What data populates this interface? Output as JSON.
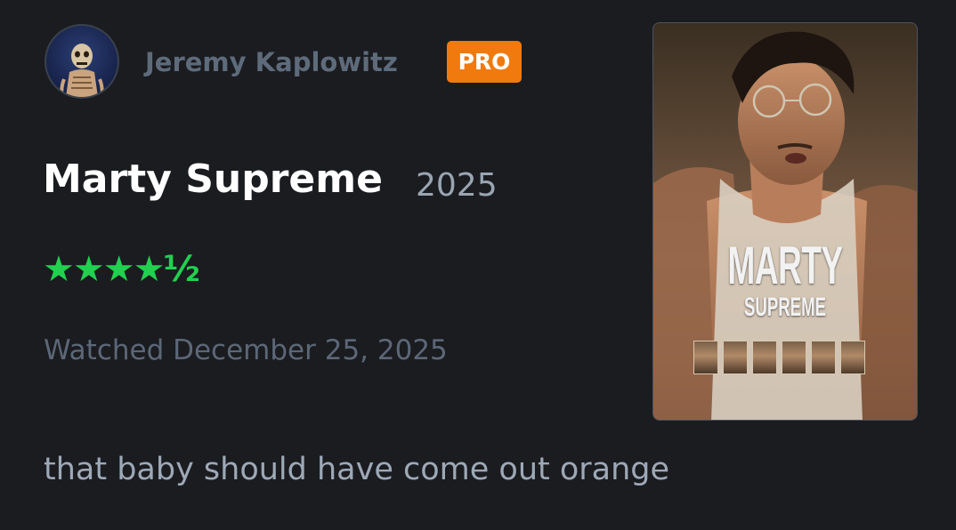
{
  "user": {
    "name": "Jeremy Kaplowitz",
    "badge": "PRO"
  },
  "film": {
    "title": "Marty Supreme",
    "year": "2025"
  },
  "rating": {
    "stars": 4.5,
    "max": 5,
    "display": "★★★★½"
  },
  "watched": "Watched December 25, 2025",
  "review": "that baby should have come out orange",
  "poster": {
    "title_line1": "MARTY",
    "title_line2": "SUPREME",
    "cast_count": 6
  },
  "colors": {
    "background": "#1a1c20",
    "pro_badge": "#f07a0e",
    "stars": "#21d04f",
    "username": "#5e6b7b",
    "title": "#ffffff",
    "year": "#9aa5b2",
    "watched": "#5c6777",
    "review": "#9ea9b7"
  },
  "icons": {
    "avatar": "skeleton-avatar"
  }
}
